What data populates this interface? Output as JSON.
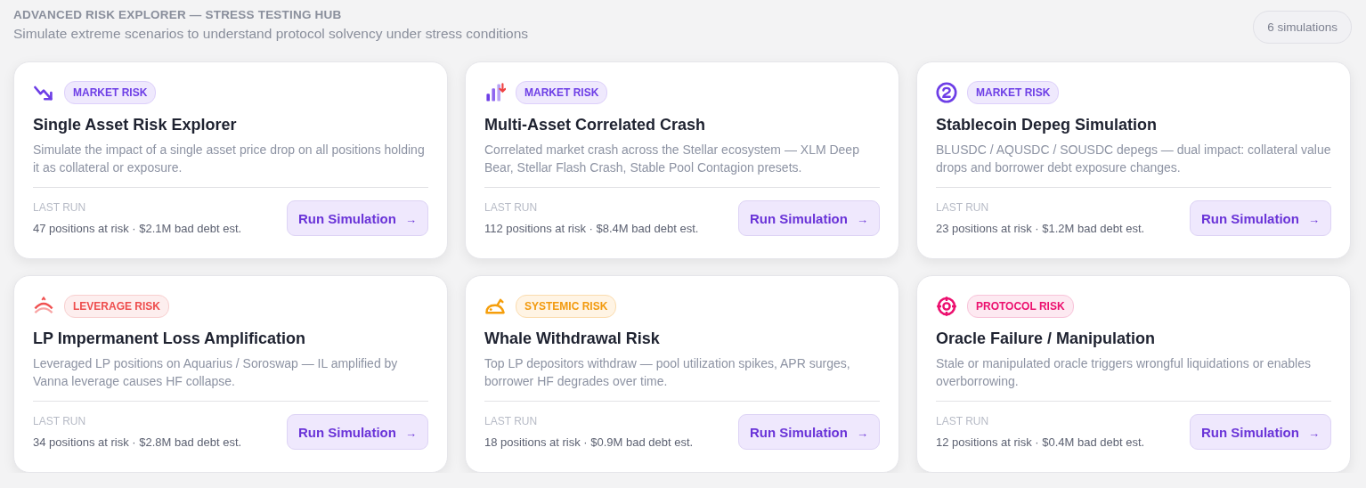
{
  "header": {
    "title": "ADVANCED RISK EXPLORER — STRESS TESTING HUB",
    "subtitle": "Simulate extreme scenarios to understand protocol solvency under stress conditions",
    "count_badge": "6 simulations"
  },
  "cards": [
    {
      "tag": {
        "label": "MARKET RISK",
        "kind": "market"
      },
      "title": "Single Asset Risk Explorer",
      "description": "Simulate the impact of a single asset price drop on all positions holding it as collateral or exposure.",
      "last_run_label": "LAST RUN",
      "last_run": "47 positions at risk · $2.1M bad debt est.",
      "button": "Run Simulation",
      "button_icon": "→"
    },
    {
      "tag": {
        "label": "MARKET RISK",
        "kind": "market"
      },
      "title": "Multi-Asset Correlated Crash",
      "description": "Correlated market crash across the Stellar ecosystem — XLM Deep Bear, Stellar Flash Crash, Stable Pool Contagion presets.",
      "last_run_label": "LAST RUN",
      "last_run": "112 positions at risk · $8.4M bad debt est.",
      "button": "Run Simulation",
      "button_icon": "→"
    },
    {
      "tag": {
        "label": "MARKET RISK",
        "kind": "market"
      },
      "title": "Stablecoin Depeg Simulation",
      "description": "BLUSDC / AQUSDC / SOUSDC depegs — dual impact: collateral value drops and borrower debt exposure changes.",
      "last_run_label": "LAST RUN",
      "last_run": "23 positions at risk · $1.2M bad debt est.",
      "button": "Run Simulation",
      "button_icon": "→"
    },
    {
      "tag": {
        "label": "LEVERAGE RISK",
        "kind": "leverage"
      },
      "title": "LP Impermanent Loss Amplification",
      "description": "Leveraged LP positions on Aquarius / Soroswap — IL amplified by Vanna leverage causes HF collapse.",
      "last_run_label": "LAST RUN",
      "last_run": "34 positions at risk · $2.8M bad debt est.",
      "button": "Run Simulation",
      "button_icon": "→"
    },
    {
      "tag": {
        "label": "SYSTEMIC RISK",
        "kind": "systemic"
      },
      "title": "Whale Withdrawal Risk",
      "description": "Top LP depositors withdraw — pool utilization spikes, APR surges, borrower HF degrades over time.",
      "last_run_label": "LAST RUN",
      "last_run": "18 positions at risk · $0.9M bad debt est.",
      "button": "Run Simulation",
      "button_icon": "→"
    },
    {
      "tag": {
        "label": "PROTOCOL RISK",
        "kind": "protocol"
      },
      "title": "Oracle Failure / Manipulation",
      "description": "Stale or manipulated oracle triggers wrongful liquidations or enables overborrowing.",
      "last_run_label": "LAST RUN",
      "last_run": "12 positions at risk · $0.4M bad debt est.",
      "button": "Run Simulation",
      "button_icon": "→"
    }
  ]
}
